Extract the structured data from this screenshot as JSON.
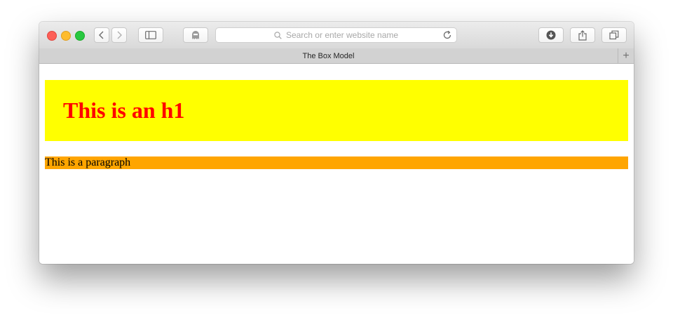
{
  "browser": {
    "address_placeholder": "Search or enter website name",
    "tab_title": "The Box Model",
    "new_tab_label": "+",
    "icons": {
      "back": "chevron-left-icon",
      "forward": "chevron-right-icon",
      "sidebar": "sidebar-icon",
      "privacy": "ghost-icon",
      "search": "search-icon",
      "reload": "reload-icon",
      "downloads": "download-icon",
      "share": "share-icon",
      "tabs": "tabs-overview-icon"
    }
  },
  "page": {
    "heading": "This is an h1",
    "paragraph": "This is a paragraph"
  },
  "colors": {
    "h1_background": "#ffff00",
    "h1_text": "#ff0000",
    "paragraph_background": "#ffa500",
    "paragraph_text": "#000000"
  }
}
